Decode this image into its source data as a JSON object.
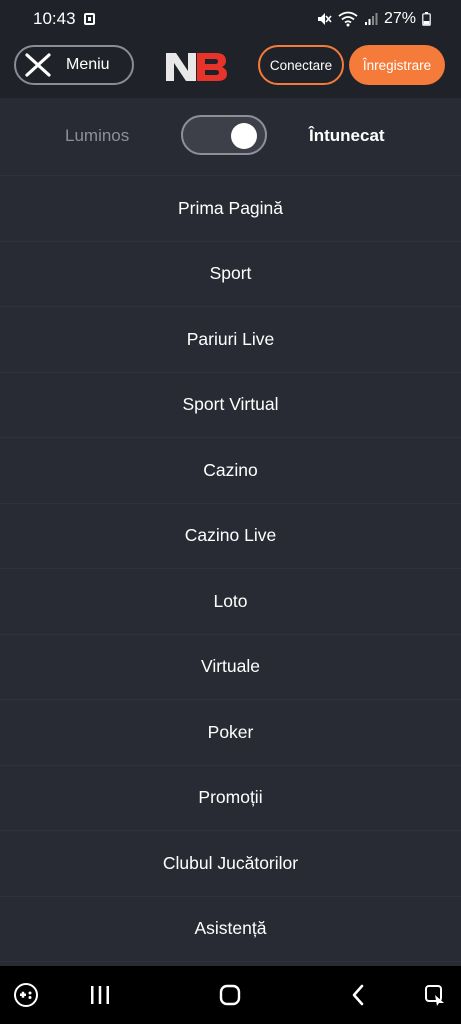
{
  "status_bar": {
    "time": "10:43",
    "battery": "27%",
    "icons": [
      "notification-icon",
      "mute-icon",
      "wifi-icon",
      "signal-icon",
      "battery-icon"
    ]
  },
  "header": {
    "menu_label": "Meniu",
    "logo_text": "NB",
    "login_label": "Conectare",
    "register_label": "Înregistrare",
    "accent_color": "#f47b3a"
  },
  "theme": {
    "light_label": "Luminos",
    "dark_label": "Întunecat",
    "selected": "dark"
  },
  "menu": {
    "items": [
      {
        "label": "Prima Pagină"
      },
      {
        "label": "Sport"
      },
      {
        "label": "Pariuri Live"
      },
      {
        "label": "Sport Virtual"
      },
      {
        "label": "Cazino"
      },
      {
        "label": "Cazino Live"
      },
      {
        "label": "Loto"
      },
      {
        "label": "Virtuale"
      },
      {
        "label": "Poker"
      },
      {
        "label": "Promoții"
      },
      {
        "label": "Clubul Jucătorilor"
      },
      {
        "label": "Asistență"
      }
    ]
  },
  "nav_bar": {
    "icons": [
      "game-launcher-icon",
      "recent-apps-icon",
      "home-icon",
      "back-icon",
      "assistant-icon"
    ]
  }
}
